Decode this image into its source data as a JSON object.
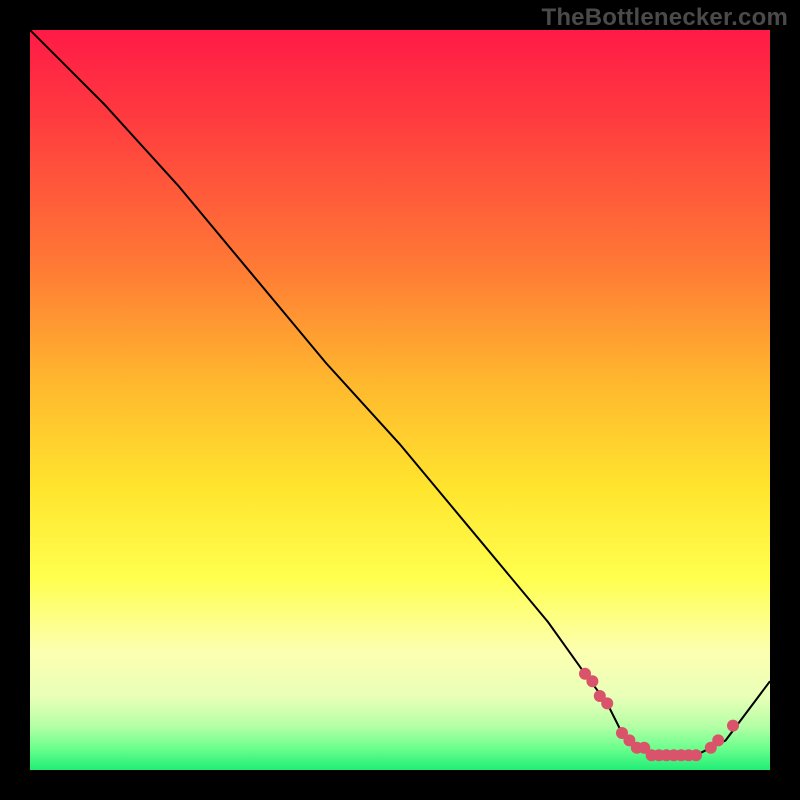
{
  "watermark": "TheBottlenecker.com",
  "colors": {
    "curve_stroke": "#000000",
    "marker_fill": "#d9536a",
    "background": "#000000"
  },
  "chart_data": {
    "type": "line",
    "title": "",
    "xlabel": "",
    "ylabel": "",
    "xlim": [
      0,
      100
    ],
    "ylim": [
      0,
      100
    ],
    "x": [
      0,
      4,
      10,
      20,
      30,
      40,
      50,
      60,
      70,
      75,
      78,
      80,
      82,
      84,
      86,
      88,
      90,
      92,
      94,
      100
    ],
    "values": [
      100,
      96,
      90,
      79,
      67,
      55,
      44,
      32,
      20,
      13,
      9,
      5,
      3,
      2,
      2,
      2,
      2,
      3,
      4,
      12
    ],
    "markers": {
      "x": [
        75,
        76,
        77,
        78,
        80,
        81,
        82,
        83,
        84,
        85,
        86,
        87,
        88,
        89,
        90,
        92,
        93,
        95
      ],
      "y": [
        13,
        12,
        10,
        9,
        5,
        4,
        3,
        3,
        2,
        2,
        2,
        2,
        2,
        2,
        2,
        3,
        4,
        6
      ]
    }
  }
}
